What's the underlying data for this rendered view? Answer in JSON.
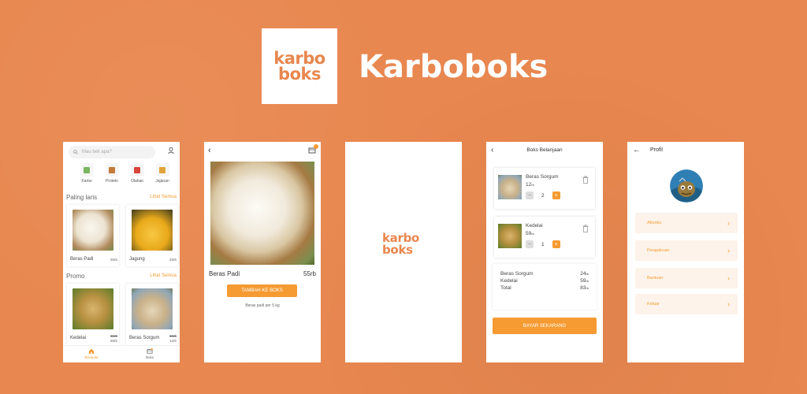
{
  "brand": {
    "logo_line1": "karbo",
    "logo_line2": "boks",
    "title": "Karboboks"
  },
  "home": {
    "search_placeholder": "Mau beli apa?",
    "categories": [
      {
        "label": "Karbo",
        "color": "#7bb661"
      },
      {
        "label": "Protein",
        "color": "#c47a3a"
      },
      {
        "label": "Olahan",
        "color": "#d9453b"
      },
      {
        "label": "Jajanan",
        "color": "#e0a43b"
      }
    ],
    "popular": {
      "title": "Paling laris",
      "link": "Lihat Semua",
      "items": [
        {
          "name": "Beras Padi",
          "price": "55rb"
        },
        {
          "name": "Jagung",
          "price": "25rb"
        }
      ]
    },
    "promo": {
      "title": "Promo",
      "link": "Lihat Semua",
      "items": [
        {
          "name": "Kedelai",
          "old_price": "65rb",
          "price": "59rb"
        },
        {
          "name": "Beras Sorgum",
          "old_price": "15rb",
          "price": "12rb"
        }
      ]
    },
    "nav": [
      {
        "label": "Beranda"
      },
      {
        "label": "Boks"
      }
    ]
  },
  "detail": {
    "product_name": "Beras Padi",
    "product_price": "55rb",
    "add_button": "TAMBAH KE BOKS",
    "description": "Beras padi per 5 kg"
  },
  "splash": {
    "line1": "karbo",
    "line2": "boks"
  },
  "cart": {
    "title": "Boks Belanjaan",
    "items": [
      {
        "name": "Beras Sorgum",
        "price": "12",
        "unit": "rb",
        "qty": "2"
      },
      {
        "name": "Kedelai",
        "price": "59",
        "unit": "rb",
        "qty": "1"
      }
    ],
    "summary": [
      {
        "label": "Beras Sorgum",
        "value": "24",
        "unit": "rb"
      },
      {
        "label": "Kedelai",
        "value": "59",
        "unit": "rb"
      },
      {
        "label": "Total",
        "value": "83",
        "unit": "rb"
      }
    ],
    "pay_button": "BAYAR SEKARANG"
  },
  "profile": {
    "title": "Profil",
    "menu": [
      {
        "label": "Akunku"
      },
      {
        "label": "Pengaturan"
      },
      {
        "label": "Bantuan"
      },
      {
        "label": "Keluar"
      }
    ]
  },
  "colors": {
    "background": "#e8874f",
    "accent": "#f59b32"
  }
}
